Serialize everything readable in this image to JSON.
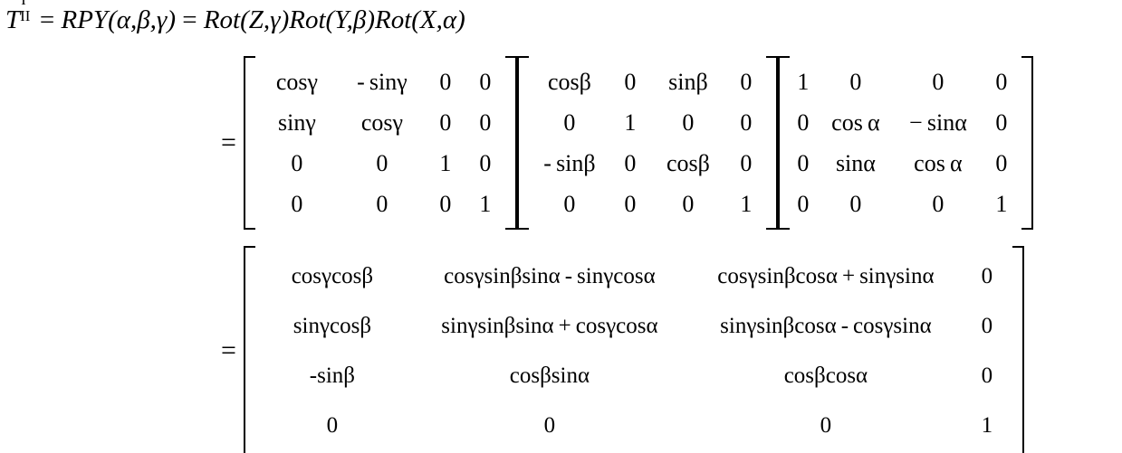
{
  "document": {
    "type": "math-equation",
    "background_color": "#ffffff",
    "text_color": "#000000"
  },
  "definition": {
    "lhs_symbol": "T",
    "lhs_superscript": "I",
    "lhs_subscript": "II",
    "equals": "=",
    "rpy": "RPY",
    "rpy_args": "(α,β,γ)",
    "equals2": "=",
    "factor1": "Rot(Z,γ)",
    "factor2": "Rot(Y,β)",
    "factor3": "Rot(X,α)",
    "full_line": "T  = RPY(α,β,γ) = Rot(Z,γ)Rot(Y,β)Rot(X,α)"
  },
  "equation1": {
    "equals": "=",
    "matrices": [
      {
        "name": "rot-z-gamma",
        "rows": [
          [
            "cosγ",
            "- sinγ",
            "0",
            "0"
          ],
          [
            "sinγ",
            "cosγ",
            "0",
            "0"
          ],
          [
            "0",
            "0",
            "1",
            "0"
          ],
          [
            "0",
            "0",
            "0",
            "1"
          ]
        ]
      },
      {
        "name": "rot-y-beta",
        "rows": [
          [
            "cosβ",
            "0",
            "sinβ",
            "0"
          ],
          [
            "0",
            "1",
            "0",
            "0"
          ],
          [
            "- sinβ",
            "0",
            "cosβ",
            "0"
          ],
          [
            "0",
            "0",
            "0",
            "1"
          ]
        ]
      },
      {
        "name": "rot-x-alpha",
        "rows": [
          [
            "1",
            "0",
            "0",
            "0"
          ],
          [
            "0",
            "cos α",
            "− sinα",
            "0"
          ],
          [
            "0",
            "sinα",
            "cos α",
            "0"
          ],
          [
            "0",
            "0",
            "0",
            "1"
          ]
        ]
      }
    ]
  },
  "equation2": {
    "equals": "=",
    "matrix": {
      "name": "rpy-product-result",
      "rows": [
        [
          "cosγcosβ",
          "cosγsinβsinα - sinγcosα",
          "cosγsinβcosα + sinγsinα",
          "0"
        ],
        [
          "sinγcosβ",
          "sinγsinβsinα + cosγcosα",
          "sinγsinβcosα - cosγsinα",
          "0"
        ],
        [
          "-sinβ",
          "cosβsinα",
          "cosβcosα",
          "0"
        ],
        [
          "0",
          "0",
          "0",
          "1"
        ]
      ]
    }
  }
}
